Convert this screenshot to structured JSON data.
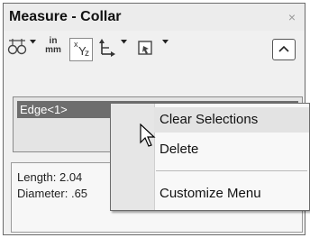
{
  "panel": {
    "title": "Measure - Collar",
    "close_glyph": "×"
  },
  "toolbar": {
    "units_top": "in",
    "units_bottom": "mm",
    "xyz_x": "x",
    "xyz_y": "Y",
    "xyz_z": "z",
    "collapse_glyph": "⌃",
    "icons": [
      "arc-center-icon",
      "units-icon",
      "xyz-coordinate-icon",
      "projection-axes-icon",
      "history-view-icon",
      "collapse-icon"
    ]
  },
  "selection": {
    "item": "Edge<1>"
  },
  "results": {
    "length": "Length: 2.04",
    "diameter": "Diameter: .65"
  },
  "context_menu": {
    "items": [
      {
        "label": "Clear Selections",
        "highlighted": true
      },
      {
        "label": "Delete",
        "highlighted": false
      },
      {
        "label": "Customize Menu",
        "highlighted": false
      }
    ]
  }
}
